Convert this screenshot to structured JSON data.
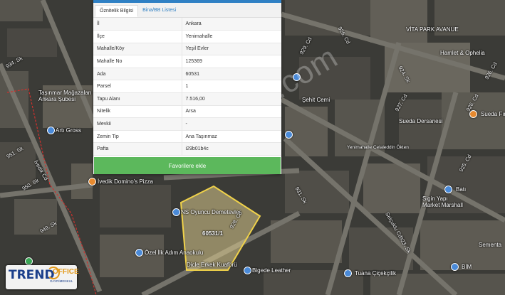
{
  "tabs": [
    {
      "label": "Öznitelik Bilgisi"
    },
    {
      "label": "Bina/BB Listesi"
    }
  ],
  "attributes": [
    {
      "key": "İl",
      "value": "Ankara"
    },
    {
      "key": "İlçe",
      "value": "Yenimahalle"
    },
    {
      "key": "Mahalle/Köy",
      "value": "Yeşil Evler"
    },
    {
      "key": "Mahalle No",
      "value": "125369"
    },
    {
      "key": "Ada",
      "value": "60531"
    },
    {
      "key": "Parsel",
      "value": "1"
    },
    {
      "key": "Tapu Alanı",
      "value": "7.516,00"
    },
    {
      "key": "Nitelik",
      "value": "Arsa"
    },
    {
      "key": "Mevkii",
      "value": "-"
    },
    {
      "key": "Zemin Tip",
      "value": "Ana Taşınmaz"
    },
    {
      "key": "Pafta",
      "value": "i29b01b4c"
    }
  ],
  "favorite_button": "Favorilere ekle",
  "watermark": "emlakjet.com",
  "parcel_label": "60531/1",
  "map_labels": {
    "vita_park": "VİTA PARK AVANUE",
    "hamlet": "Hamlet & Ophelia",
    "sueda_firin": "Sueda Fırın",
    "sueda_dersane": "Sueda Dersanesi",
    "tasinmar": "Taşınmar Mağazaları",
    "ankara_subesi": "Ankara Şubesi",
    "arti_gross": "Artı Gross",
    "ivedik_dominos": "İvedik Domino's Pizza",
    "ns_oyuncu": "NS Oyuncu Demetevler",
    "ozel_ilk": "Özel İlk Adım Anaokulu",
    "sigin_yapi": "Sigin Yapı",
    "market_marshall": "Market Marshall",
    "bim": "BİM",
    "tuana": "Tuana Çiçekçilik",
    "bigede": "Bigede Leather",
    "yenimahalle_okul": "Yenimahalle Celaleddin Ökten",
    "sehit": "Şehit Cemi",
    "sementa": "Sementa",
    "bati": "Batı",
    "kuafor": "Dicle Erkek Kuaförü",
    "street_934": "934. Sk",
    "street_951": "951. Sk",
    "street_950": "950. Sk",
    "street_949": "949. Sk",
    "street_ivedik": "İvedik Cd",
    "street_926_a": "926. Cd",
    "street_926_b": "926. Cd",
    "street_926_c": "926. Cd",
    "street_925": "925. Cd",
    "street_927": "927. Cd",
    "street_928": "928. Cd",
    "street_929": "929. Cd",
    "street_924": "924. Sk",
    "street_931": "931. Sk",
    "street_923": "923. Sk",
    "street_selcuklu": "Selçuklu Cd"
  },
  "logo": {
    "brand": "TREND",
    "suffix": "OFFICE",
    "tagline": "GAYRİMENKUL"
  },
  "colors": {
    "tab_accent": "#2f80c4",
    "button": "#5cb85c",
    "parcel_fill": "#d8c98c",
    "parcel_border": "#f0d24a",
    "road": "#6e6d66"
  }
}
